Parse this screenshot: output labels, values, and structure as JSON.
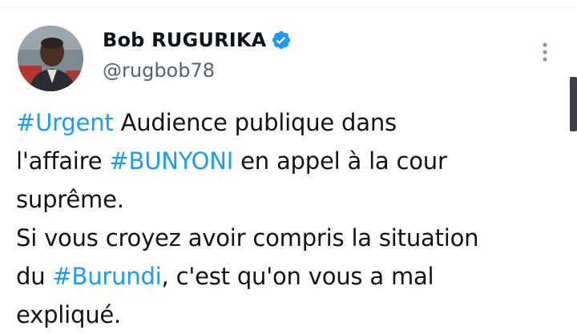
{
  "author": {
    "display_name": "Bob RUGURIKA",
    "handle": "@rugbob78",
    "verified": true,
    "verified_color": "#1d9bf0",
    "avatar_icon": "profile-photo"
  },
  "actions": {
    "more_icon": "vertical-dots-icon"
  },
  "tweet": {
    "line1": {
      "hashtag": "#Urgent",
      "rest": " Audience publique dans"
    },
    "line2": {
      "pre": "l'affaire ",
      "hashtag": "#BUNYONI",
      "post": " en appel à la cour"
    },
    "line3": "suprême.",
    "line4": "Si vous croyez avoir compris la situation",
    "line5": {
      "pre": "du ",
      "hashtag": "#Burundi",
      "post": ", c'est qu'on vous a mal"
    },
    "line6": "expliqué."
  },
  "colors": {
    "text": "#0f1419",
    "secondary": "#536471",
    "link": "#1d9bf0"
  }
}
